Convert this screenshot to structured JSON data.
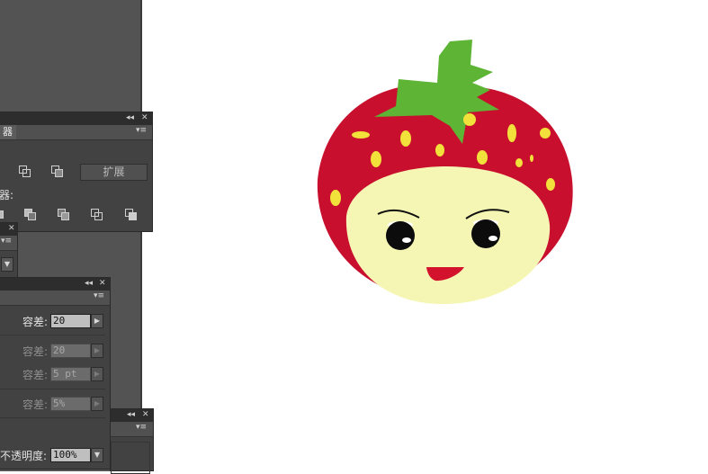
{
  "pathfinder_panel": {
    "tab_label": "器",
    "expand_button": "扩展",
    "row2_label": "器:",
    "collapse_icon": "double-chevron-left-icon",
    "close_icon": "close-icon",
    "menu_icon": "panel-menu-icon"
  },
  "magic_wand_panel": {
    "fill_tolerance_label": "容差:",
    "fill_tolerance_value": "20",
    "stroke_tolerance_label": "容差:",
    "stroke_tolerance_value": "20",
    "stroke_weight_label": "容差:",
    "stroke_weight_value": "5 pt",
    "opacity_tolerance_label": "容差:",
    "opacity_tolerance_value": "5%"
  },
  "transparency_panel": {
    "opacity_label": "不透明度:",
    "opacity_value": "100%"
  },
  "colors": {
    "workspace": "#535353",
    "panel": "#424242",
    "strawberry_red": "#c8102e",
    "leaf_green": "#5db435",
    "face_cream": "#f6f6b4",
    "seed_yellow": "#f2e13a"
  }
}
